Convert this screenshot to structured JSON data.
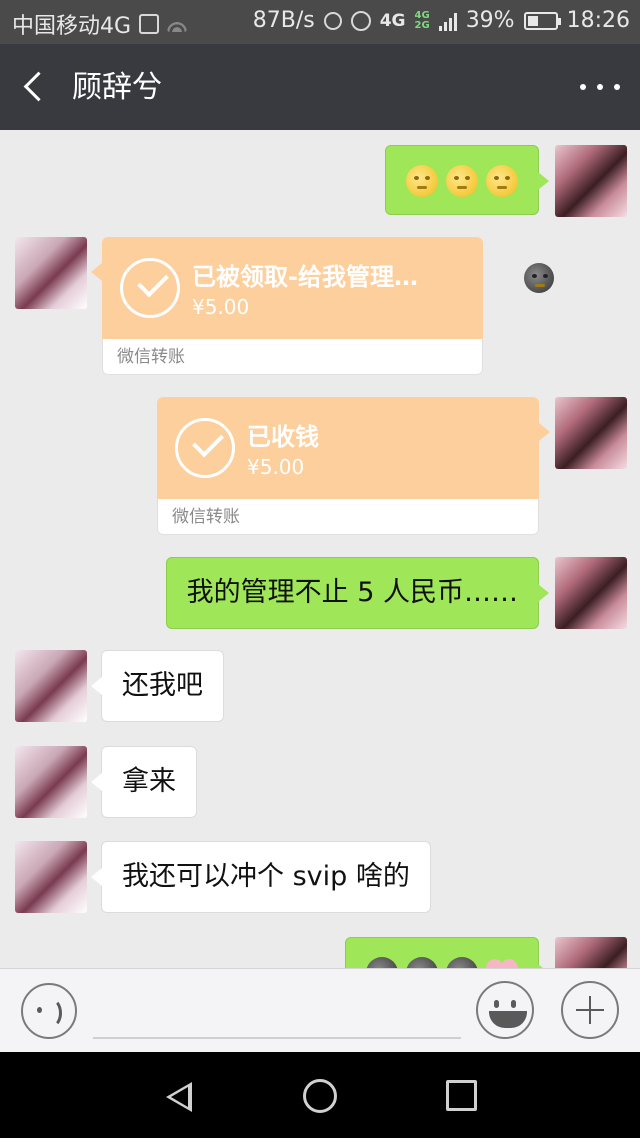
{
  "status_bar": {
    "carrier": "中国移动4G",
    "speed": "87B/s",
    "network_a": "4G",
    "network_b": "4G",
    "network_b2": "2G",
    "battery": "39%",
    "battery_level": 0.39,
    "time": "18:26"
  },
  "header": {
    "title": "顾辞兮"
  },
  "messages": [
    {
      "side": "me",
      "kind": "emoji",
      "emojis": [
        "moon-face",
        "moon-face",
        "moon-face"
      ]
    },
    {
      "side": "her",
      "kind": "transfer",
      "title": "已被领取-给我管理…",
      "amount": "¥5.00",
      "footer": "微信转账",
      "trailing_emoji": "new-moon-face"
    },
    {
      "side": "me",
      "kind": "transfer",
      "title": "已收钱",
      "amount": "¥5.00",
      "footer": "微信转账"
    },
    {
      "side": "me",
      "kind": "text",
      "text": "我的管理不止 5 人民币……"
    },
    {
      "side": "her",
      "kind": "text",
      "text": "还我吧"
    },
    {
      "side": "her",
      "kind": "text",
      "text": "拿来"
    },
    {
      "side": "her",
      "kind": "text",
      "text": "我还可以冲个 svip 啥的"
    },
    {
      "side": "me",
      "kind": "emoji",
      "emojis": [
        "new-moon-face",
        "new-moon-face",
        "new-moon-face",
        "pink-heart"
      ]
    }
  ],
  "input": {
    "value": "",
    "placeholder": ""
  },
  "icons": {
    "back": "back-arrow-icon",
    "more": "more-dots-icon",
    "voice": "voice-icon",
    "emoji": "emoji-icon",
    "plus": "plus-icon",
    "transfer": "check-circle-icon"
  },
  "colors": {
    "my_bubble": "#9fe658",
    "her_bubble": "#ffffff",
    "transfer_card": "#fdcf9c",
    "header_bg": "#393a3f",
    "chat_bg": "#ebebeb"
  }
}
